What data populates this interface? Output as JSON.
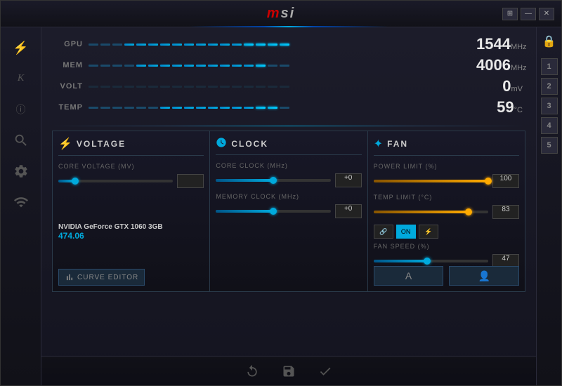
{
  "app": {
    "title": "msi",
    "title_color": "#cc0000"
  },
  "window_controls": {
    "win_label": "⊞",
    "min_label": "—",
    "close_label": "✕"
  },
  "sidebar": {
    "icons": [
      {
        "name": "overclocking-icon",
        "glyph": "⚡"
      },
      {
        "name": "profiles-icon",
        "glyph": "K"
      },
      {
        "name": "info-icon",
        "glyph": "ⓘ"
      },
      {
        "name": "search-icon",
        "glyph": "🔍"
      },
      {
        "name": "settings-icon",
        "glyph": "⚙"
      },
      {
        "name": "monitor-icon",
        "glyph": "📊"
      }
    ]
  },
  "right_sidebar": {
    "lock_label": "🔒",
    "profiles": [
      "1",
      "2",
      "3",
      "4",
      "5"
    ]
  },
  "meters": [
    {
      "label": "GPU",
      "value": "1544",
      "unit": "MHz",
      "fill_pct": 72,
      "dashes_active": 14,
      "dashes_total": 17
    },
    {
      "label": "MEM",
      "value": "4006",
      "unit": "MHz",
      "fill_pct": 60,
      "dashes_active": 12,
      "dashes_total": 17
    },
    {
      "label": "VOLT",
      "value": "0",
      "unit": "mV",
      "fill_pct": 0,
      "dashes_active": 0,
      "dashes_total": 17
    },
    {
      "label": "TEMP",
      "value": "59",
      "unit": "°C",
      "fill_pct": 55,
      "dashes_active": 11,
      "dashes_total": 17
    }
  ],
  "panels": {
    "voltage": {
      "title": "VOLTAGE",
      "icon": "⚡",
      "control_label": "CORE VOLTAGE (MV)",
      "slider_value": "",
      "gpu_name": "NVIDIA GeForce GTX 1060 3GB",
      "gpu_score": "474.06",
      "curve_editor_label": "CURVE EDITOR"
    },
    "clock": {
      "title": "CLOCK",
      "icon": "◉",
      "core_label": "CORE CLOCK (MHz)",
      "core_value": "+0",
      "memory_label": "MEMORY CLOCK (MHz)",
      "memory_value": "+0"
    },
    "fan": {
      "title": "FAN",
      "icon": "✦",
      "power_limit_label": "POWER LIMIT (%)",
      "power_limit_value": "100",
      "temp_limit_label": "TEMP LIMIT (°C)",
      "temp_limit_value": "83",
      "toggles": [
        {
          "label": "🔗",
          "active": false
        },
        {
          "label": "ON",
          "active": true
        },
        {
          "label": "⚡",
          "active": false
        }
      ],
      "fan_speed_label": "FAN SPEED (%)",
      "fan_speed_value": "47",
      "profile_btns": [
        "A",
        "👤"
      ]
    }
  },
  "toolbar": {
    "reset_label": "↺",
    "save_label": "💾",
    "apply_label": "✓"
  }
}
